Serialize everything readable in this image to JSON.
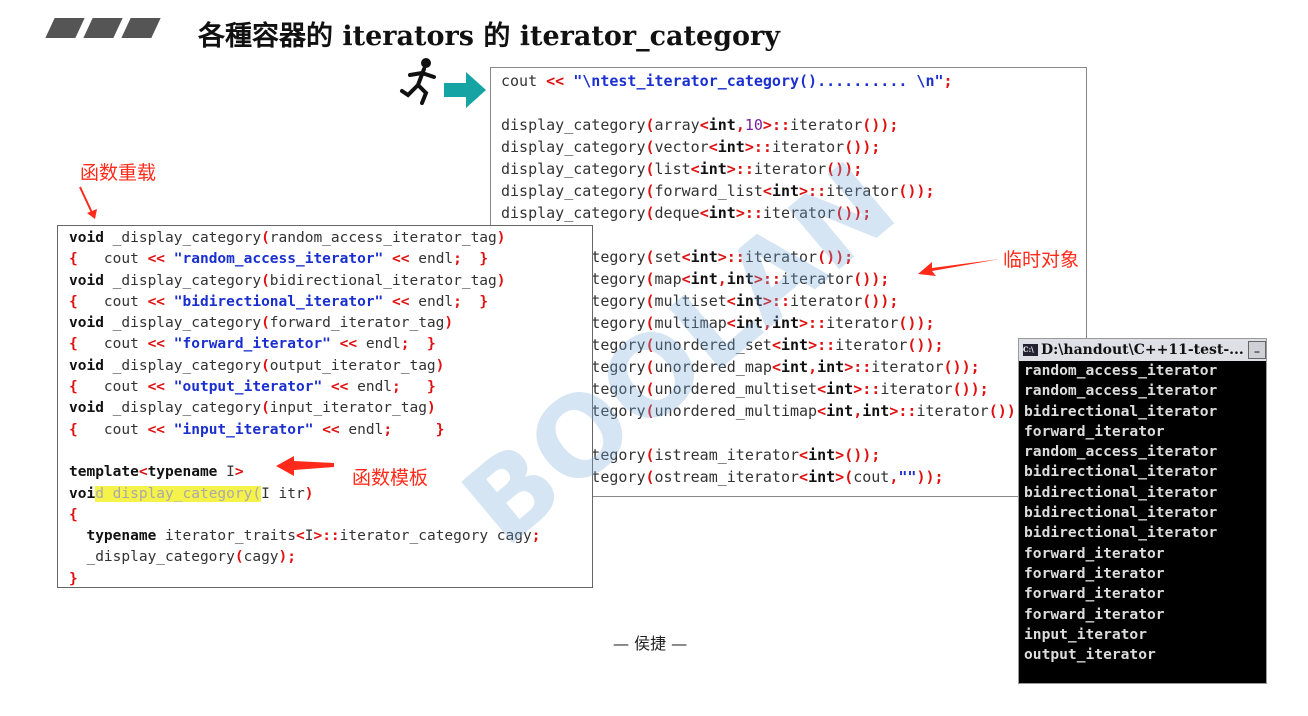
{
  "title": "各種容器的 iterators 的 iterator_category",
  "icons": {
    "runner": "running-man-icon",
    "arrow": "teal-right-arrow-icon"
  },
  "colors": {
    "keyword": "#111111",
    "string": "#1a2fd0",
    "punct": "#e01010",
    "note": "#ff2a1a",
    "arrow": "#16a3a3"
  },
  "notes": {
    "overload": "函数重载",
    "temp_object": "临时对象",
    "template": "函数模板"
  },
  "author": "— 侯捷 —",
  "watermark": "BOOLAN",
  "right_code": [
    [
      [
        "cout ",
        "t"
      ],
      [
        "<<",
        "p"
      ],
      [
        " \"\\ntest_iterator_category().......... \\n\"",
        "s"
      ],
      [
        ";",
        "p"
      ]
    ],
    [],
    [
      [
        "display_category",
        "t"
      ],
      [
        "(",
        "p"
      ],
      [
        "array",
        "t"
      ],
      [
        "<",
        "p"
      ],
      [
        "int",
        "k"
      ],
      [
        ",",
        "p"
      ],
      [
        "10",
        "n"
      ],
      [
        ">",
        "p"
      ],
      [
        "::",
        "p"
      ],
      [
        "iterator",
        "t"
      ],
      [
        "());",
        "p"
      ]
    ],
    [
      [
        "display_category",
        "t"
      ],
      [
        "(",
        "p"
      ],
      [
        "vector",
        "t"
      ],
      [
        "<",
        "p"
      ],
      [
        "int",
        "k"
      ],
      [
        ">::",
        "p"
      ],
      [
        "iterator",
        "t"
      ],
      [
        "());",
        "p"
      ]
    ],
    [
      [
        "display_category",
        "t"
      ],
      [
        "(",
        "p"
      ],
      [
        "list",
        "t"
      ],
      [
        "<",
        "p"
      ],
      [
        "int",
        "k"
      ],
      [
        ">::",
        "p"
      ],
      [
        "iterator",
        "t"
      ],
      [
        "());",
        "p"
      ]
    ],
    [
      [
        "display_category",
        "t"
      ],
      [
        "(",
        "p"
      ],
      [
        "forward_list",
        "t"
      ],
      [
        "<",
        "p"
      ],
      [
        "int",
        "k"
      ],
      [
        ">::",
        "p"
      ],
      [
        "iterator",
        "t"
      ],
      [
        "());",
        "p"
      ]
    ],
    [
      [
        "display_category",
        "t"
      ],
      [
        "(",
        "p"
      ],
      [
        "deque",
        "t"
      ],
      [
        "<",
        "p"
      ],
      [
        "int",
        "k"
      ],
      [
        ">::",
        "p"
      ],
      [
        "iterator",
        "t"
      ],
      [
        "());",
        "p"
      ]
    ],
    [],
    [
      [
        "display_category",
        "t"
      ],
      [
        "(",
        "p"
      ],
      [
        "set",
        "t"
      ],
      [
        "<",
        "p"
      ],
      [
        "int",
        "k"
      ],
      [
        ">::",
        "p"
      ],
      [
        "iterator",
        "t"
      ],
      [
        "());",
        "p"
      ]
    ],
    [
      [
        "display_category",
        "t"
      ],
      [
        "(",
        "p"
      ],
      [
        "map",
        "t"
      ],
      [
        "<",
        "p"
      ],
      [
        "int",
        "k"
      ],
      [
        ",",
        "p"
      ],
      [
        "int",
        "k"
      ],
      [
        ">::",
        "p"
      ],
      [
        "iterator",
        "t"
      ],
      [
        "());",
        "p"
      ]
    ],
    [
      [
        "display_category",
        "t"
      ],
      [
        "(",
        "p"
      ],
      [
        "multiset",
        "t"
      ],
      [
        "<",
        "p"
      ],
      [
        "int",
        "k"
      ],
      [
        ">::",
        "p"
      ],
      [
        "iterator",
        "t"
      ],
      [
        "());",
        "p"
      ]
    ],
    [
      [
        "display_category",
        "t"
      ],
      [
        "(",
        "p"
      ],
      [
        "multimap",
        "t"
      ],
      [
        "<",
        "p"
      ],
      [
        "int",
        "k"
      ],
      [
        ",",
        "p"
      ],
      [
        "int",
        "k"
      ],
      [
        ">::",
        "p"
      ],
      [
        "iterator",
        "t"
      ],
      [
        "());",
        "p"
      ]
    ],
    [
      [
        "display_category",
        "t"
      ],
      [
        "(",
        "p"
      ],
      [
        "unordered_set",
        "t"
      ],
      [
        "<",
        "p"
      ],
      [
        "int",
        "k"
      ],
      [
        ">::",
        "p"
      ],
      [
        "iterator",
        "t"
      ],
      [
        "());",
        "p"
      ]
    ],
    [
      [
        "display_category",
        "t"
      ],
      [
        "(",
        "p"
      ],
      [
        "unordered_map",
        "t"
      ],
      [
        "<",
        "p"
      ],
      [
        "int",
        "k"
      ],
      [
        ",",
        "p"
      ],
      [
        "int",
        "k"
      ],
      [
        ">::",
        "p"
      ],
      [
        "iterator",
        "t"
      ],
      [
        "());",
        "p"
      ]
    ],
    [
      [
        "display_category",
        "t"
      ],
      [
        "(",
        "p"
      ],
      [
        "unordered_multiset",
        "t"
      ],
      [
        "<",
        "p"
      ],
      [
        "int",
        "k"
      ],
      [
        ">::",
        "p"
      ],
      [
        "iterator",
        "t"
      ],
      [
        "());",
        "p"
      ]
    ],
    [
      [
        "display_category",
        "t"
      ],
      [
        "(",
        "p"
      ],
      [
        "unordered_multimap",
        "t"
      ],
      [
        "<",
        "p"
      ],
      [
        "int",
        "k"
      ],
      [
        ",",
        "p"
      ],
      [
        "int",
        "k"
      ],
      [
        ">::",
        "p"
      ],
      [
        "iterator",
        "t"
      ],
      [
        "());",
        "p"
      ]
    ],
    [],
    [
      [
        "display_category",
        "t"
      ],
      [
        "(",
        "p"
      ],
      [
        "istream_iterator",
        "t"
      ],
      [
        "<",
        "p"
      ],
      [
        "int",
        "k"
      ],
      [
        ">",
        "p"
      ],
      [
        "());",
        "p"
      ]
    ],
    [
      [
        "display_category",
        "t"
      ],
      [
        "(",
        "p"
      ],
      [
        "ostream_iterator",
        "t"
      ],
      [
        "<",
        "p"
      ],
      [
        "int",
        "k"
      ],
      [
        ">",
        "p"
      ],
      [
        "(",
        "p"
      ],
      [
        "cout",
        "t"
      ],
      [
        ",",
        "p"
      ],
      [
        "\"\"",
        "s"
      ],
      [
        "));",
        "p"
      ]
    ]
  ],
  "left_code": [
    [
      [
        "void",
        "k"
      ],
      [
        " _display_category",
        "t"
      ],
      [
        "(",
        "p"
      ],
      [
        "random_access_iterator_tag",
        "t"
      ],
      [
        ")",
        "p"
      ]
    ],
    [
      [
        "{",
        "p"
      ],
      [
        "   cout ",
        "t"
      ],
      [
        "<<",
        "p"
      ],
      [
        " \"random_access_iterator\" ",
        "s"
      ],
      [
        "<<",
        "p"
      ],
      [
        " endl",
        "t"
      ],
      [
        ";",
        "p"
      ],
      [
        "  }",
        "p"
      ]
    ],
    [
      [
        "void",
        "k"
      ],
      [
        " _display_category",
        "t"
      ],
      [
        "(",
        "p"
      ],
      [
        "bidirectional_iterator_tag",
        "t"
      ],
      [
        ")",
        "p"
      ]
    ],
    [
      [
        "{",
        "p"
      ],
      [
        "   cout ",
        "t"
      ],
      [
        "<<",
        "p"
      ],
      [
        " \"bidirectional_iterator\" ",
        "s"
      ],
      [
        "<<",
        "p"
      ],
      [
        " endl",
        "t"
      ],
      [
        ";",
        "p"
      ],
      [
        "  }",
        "p"
      ]
    ],
    [
      [
        "void",
        "k"
      ],
      [
        " _display_category",
        "t"
      ],
      [
        "(",
        "p"
      ],
      [
        "forward_iterator_tag",
        "t"
      ],
      [
        ")",
        "p"
      ]
    ],
    [
      [
        "{",
        "p"
      ],
      [
        "   cout ",
        "t"
      ],
      [
        "<<",
        "p"
      ],
      [
        " \"forward_iterator\" ",
        "s"
      ],
      [
        "<<",
        "p"
      ],
      [
        " endl",
        "t"
      ],
      [
        ";",
        "p"
      ],
      [
        "  }",
        "p"
      ]
    ],
    [
      [
        "void",
        "k"
      ],
      [
        " _display_category",
        "t"
      ],
      [
        "(",
        "p"
      ],
      [
        "output_iterator_tag",
        "t"
      ],
      [
        ")",
        "p"
      ]
    ],
    [
      [
        "{",
        "p"
      ],
      [
        "   cout ",
        "t"
      ],
      [
        "<<",
        "p"
      ],
      [
        " \"output_iterator\" ",
        "s"
      ],
      [
        "<<",
        "p"
      ],
      [
        " endl",
        "t"
      ],
      [
        ";",
        "p"
      ],
      [
        "   }",
        "p"
      ]
    ],
    [
      [
        "void",
        "k"
      ],
      [
        " _display_category",
        "t"
      ],
      [
        "(",
        "p"
      ],
      [
        "input_iterator_tag",
        "t"
      ],
      [
        ")",
        "p"
      ]
    ],
    [
      [
        "{",
        "p"
      ],
      [
        "   cout ",
        "t"
      ],
      [
        "<<",
        "p"
      ],
      [
        " \"input_iterator\" ",
        "s"
      ],
      [
        "<<",
        "p"
      ],
      [
        " endl",
        "t"
      ],
      [
        ";",
        "p"
      ],
      [
        "     }",
        "p"
      ]
    ],
    [],
    [
      [
        "template",
        "k"
      ],
      [
        "<",
        "p"
      ],
      [
        "typename",
        "k"
      ],
      [
        " I",
        "t"
      ],
      [
        ">",
        "p"
      ]
    ],
    [
      [
        "voi",
        "k"
      ],
      [
        "d display_category(",
        "hl"
      ],
      [
        "I itr",
        "t"
      ],
      [
        ")",
        "p"
      ]
    ],
    [
      [
        "{",
        "p"
      ]
    ],
    [
      [
        "  ",
        "t"
      ],
      [
        "typename",
        "k"
      ],
      [
        " iterator_traits",
        "t"
      ],
      [
        "<",
        "p"
      ],
      [
        "I",
        "t"
      ],
      [
        ">::",
        "p"
      ],
      [
        "iterator_category cagy",
        "t"
      ],
      [
        ";",
        "p"
      ]
    ],
    [
      [
        "  _display_category",
        "t"
      ],
      [
        "(",
        "p"
      ],
      [
        "cagy",
        "t"
      ],
      [
        ");",
        "p"
      ]
    ],
    [
      [
        "}",
        "p"
      ]
    ]
  ],
  "console": {
    "title": "D:\\handout\\C++11-test-...",
    "icon": "C:\\",
    "lines": [
      "random_access_iterator",
      "random_access_iterator",
      "bidirectional_iterator",
      "forward_iterator",
      "random_access_iterator",
      "bidirectional_iterator",
      "bidirectional_iterator",
      "bidirectional_iterator",
      "bidirectional_iterator",
      "forward_iterator",
      "forward_iterator",
      "forward_iterator",
      "forward_iterator",
      "input_iterator",
      "output_iterator"
    ]
  }
}
